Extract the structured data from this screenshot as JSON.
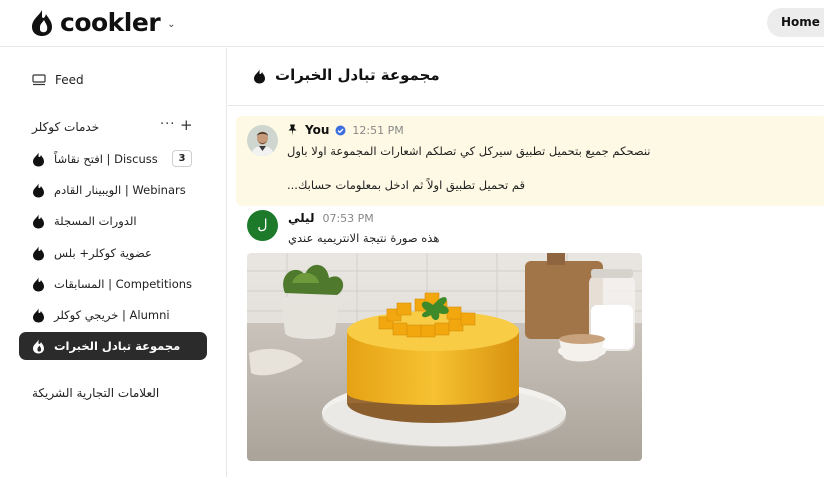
{
  "header": {
    "brand": "cookler",
    "brand_chevron": "⌄",
    "home_label": "Home"
  },
  "sidebar": {
    "feed_label": "Feed",
    "group_title": "خدمات كوكلر",
    "group_more": "···",
    "group_add": "+",
    "items": [
      {
        "label": "افتح نقاشاً | Discuss",
        "badge": "3"
      },
      {
        "label": "الويبينار القادم | Webinars"
      },
      {
        "label": "الدورات المسجلة"
      },
      {
        "label": "عضوية كوكلر+ بلس"
      },
      {
        "label": "المسابقات | Competitions"
      },
      {
        "label": "خريجي كوكلر | Alumni"
      },
      {
        "label": "مجموعة تبادل الخبرات"
      }
    ],
    "partners_label": "العلامات التجارية الشريكة"
  },
  "room": {
    "title": "مجموعة تبادل الخبرات"
  },
  "messages": {
    "pinned": {
      "author": "You",
      "time": "12:51 PM",
      "line1": "ننصحكم جميع بتحميل تطبيق سيركل كي تصلكم اشعارات المجموعة اولا باول",
      "line2": "قم تحميل تطبيق اولاً ثم ادخل بمعلومات حسابك..."
    },
    "second": {
      "avatar_letter": "ل",
      "author": "ليلي",
      "time": "07:53 PM",
      "text": "هذه صورة نتيجة الانتريميه عندي"
    }
  },
  "colors": {
    "active_nav": "#2b2b2b",
    "pinned_bg": "#fdf9e4",
    "avatar_green": "#1d7a2b",
    "verified_blue": "#3b6fe0"
  }
}
